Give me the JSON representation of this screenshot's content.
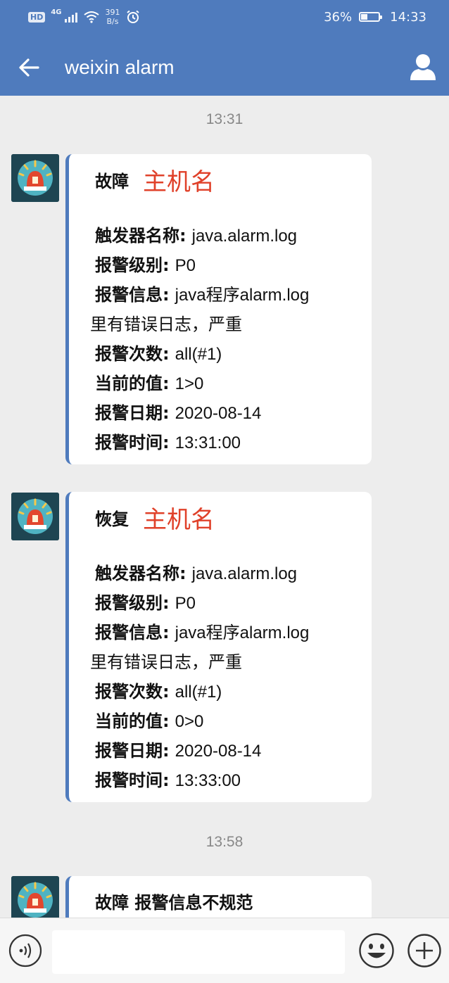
{
  "status_bar": {
    "hd": "HD",
    "network": "4G",
    "speed_value": "391",
    "speed_unit": "B/s",
    "battery_percent": "36%",
    "battery_level": 0.36,
    "clock": "14:33"
  },
  "header": {
    "title": "weixin alarm",
    "back_icon": "arrow-left-icon",
    "profile_icon": "person-icon"
  },
  "timestamps": [
    "13:31",
    "13:58"
  ],
  "messages": [
    {
      "status": "故障",
      "host": "主机名",
      "rows": [
        {
          "k": "触发器名称:",
          "v": "java.alarm.log"
        },
        {
          "k": "报警级别:",
          "v": "P0"
        },
        {
          "k": "报警信息:",
          "v": "java程序alarm.log"
        },
        {
          "k": "报警次数:",
          "v": "all(#1)"
        },
        {
          "k": "当前的值:",
          "v": "1>0"
        },
        {
          "k": "报警日期:",
          "v": "2020-08-14"
        },
        {
          "k": "报警时间:",
          "v": "13:31:00"
        }
      ],
      "continuation": "里有错误日志，严重"
    },
    {
      "status": "恢复",
      "host": "主机名",
      "rows": [
        {
          "k": "触发器名称:",
          "v": "java.alarm.log"
        },
        {
          "k": "报警级别:",
          "v": "P0"
        },
        {
          "k": "报警信息:",
          "v": "java程序alarm.log"
        },
        {
          "k": "报警次数:",
          "v": "all(#1)"
        },
        {
          "k": "当前的值:",
          "v": "0>0"
        },
        {
          "k": "报警日期:",
          "v": "2020-08-14"
        },
        {
          "k": "报警时间:",
          "v": "13:33:00"
        }
      ],
      "continuation": "里有错误日志，严重"
    },
    {
      "title": "故障 报警信息不规范"
    }
  ],
  "input_bar": {
    "voice_icon": "voice-icon",
    "emoji_icon": "emoji-icon",
    "add_icon": "plus-icon"
  }
}
